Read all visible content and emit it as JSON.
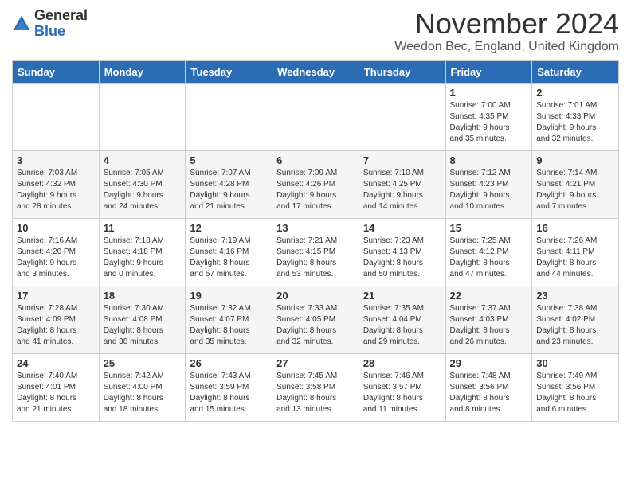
{
  "logo": {
    "general": "General",
    "blue": "Blue"
  },
  "title": "November 2024",
  "subtitle": "Weedon Bec, England, United Kingdom",
  "days_of_week": [
    "Sunday",
    "Monday",
    "Tuesday",
    "Wednesday",
    "Thursday",
    "Friday",
    "Saturday"
  ],
  "weeks": [
    [
      {
        "day": "",
        "info": ""
      },
      {
        "day": "",
        "info": ""
      },
      {
        "day": "",
        "info": ""
      },
      {
        "day": "",
        "info": ""
      },
      {
        "day": "",
        "info": ""
      },
      {
        "day": "1",
        "info": "Sunrise: 7:00 AM\nSunset: 4:35 PM\nDaylight: 9 hours\nand 35 minutes."
      },
      {
        "day": "2",
        "info": "Sunrise: 7:01 AM\nSunset: 4:33 PM\nDaylight: 9 hours\nand 32 minutes."
      }
    ],
    [
      {
        "day": "3",
        "info": "Sunrise: 7:03 AM\nSunset: 4:32 PM\nDaylight: 9 hours\nand 28 minutes."
      },
      {
        "day": "4",
        "info": "Sunrise: 7:05 AM\nSunset: 4:30 PM\nDaylight: 9 hours\nand 24 minutes."
      },
      {
        "day": "5",
        "info": "Sunrise: 7:07 AM\nSunset: 4:28 PM\nDaylight: 9 hours\nand 21 minutes."
      },
      {
        "day": "6",
        "info": "Sunrise: 7:09 AM\nSunset: 4:26 PM\nDaylight: 9 hours\nand 17 minutes."
      },
      {
        "day": "7",
        "info": "Sunrise: 7:10 AM\nSunset: 4:25 PM\nDaylight: 9 hours\nand 14 minutes."
      },
      {
        "day": "8",
        "info": "Sunrise: 7:12 AM\nSunset: 4:23 PM\nDaylight: 9 hours\nand 10 minutes."
      },
      {
        "day": "9",
        "info": "Sunrise: 7:14 AM\nSunset: 4:21 PM\nDaylight: 9 hours\nand 7 minutes."
      }
    ],
    [
      {
        "day": "10",
        "info": "Sunrise: 7:16 AM\nSunset: 4:20 PM\nDaylight: 9 hours\nand 3 minutes."
      },
      {
        "day": "11",
        "info": "Sunrise: 7:18 AM\nSunset: 4:18 PM\nDaylight: 9 hours\nand 0 minutes."
      },
      {
        "day": "12",
        "info": "Sunrise: 7:19 AM\nSunset: 4:16 PM\nDaylight: 8 hours\nand 57 minutes."
      },
      {
        "day": "13",
        "info": "Sunrise: 7:21 AM\nSunset: 4:15 PM\nDaylight: 8 hours\nand 53 minutes."
      },
      {
        "day": "14",
        "info": "Sunrise: 7:23 AM\nSunset: 4:13 PM\nDaylight: 8 hours\nand 50 minutes."
      },
      {
        "day": "15",
        "info": "Sunrise: 7:25 AM\nSunset: 4:12 PM\nDaylight: 8 hours\nand 47 minutes."
      },
      {
        "day": "16",
        "info": "Sunrise: 7:26 AM\nSunset: 4:11 PM\nDaylight: 8 hours\nand 44 minutes."
      }
    ],
    [
      {
        "day": "17",
        "info": "Sunrise: 7:28 AM\nSunset: 4:09 PM\nDaylight: 8 hours\nand 41 minutes."
      },
      {
        "day": "18",
        "info": "Sunrise: 7:30 AM\nSunset: 4:08 PM\nDaylight: 8 hours\nand 38 minutes."
      },
      {
        "day": "19",
        "info": "Sunrise: 7:32 AM\nSunset: 4:07 PM\nDaylight: 8 hours\nand 35 minutes."
      },
      {
        "day": "20",
        "info": "Sunrise: 7:33 AM\nSunset: 4:05 PM\nDaylight: 8 hours\nand 32 minutes."
      },
      {
        "day": "21",
        "info": "Sunrise: 7:35 AM\nSunset: 4:04 PM\nDaylight: 8 hours\nand 29 minutes."
      },
      {
        "day": "22",
        "info": "Sunrise: 7:37 AM\nSunset: 4:03 PM\nDaylight: 8 hours\nand 26 minutes."
      },
      {
        "day": "23",
        "info": "Sunrise: 7:38 AM\nSunset: 4:02 PM\nDaylight: 8 hours\nand 23 minutes."
      }
    ],
    [
      {
        "day": "24",
        "info": "Sunrise: 7:40 AM\nSunset: 4:01 PM\nDaylight: 8 hours\nand 21 minutes."
      },
      {
        "day": "25",
        "info": "Sunrise: 7:42 AM\nSunset: 4:00 PM\nDaylight: 8 hours\nand 18 minutes."
      },
      {
        "day": "26",
        "info": "Sunrise: 7:43 AM\nSunset: 3:59 PM\nDaylight: 8 hours\nand 15 minutes."
      },
      {
        "day": "27",
        "info": "Sunrise: 7:45 AM\nSunset: 3:58 PM\nDaylight: 8 hours\nand 13 minutes."
      },
      {
        "day": "28",
        "info": "Sunrise: 7:46 AM\nSunset: 3:57 PM\nDaylight: 8 hours\nand 11 minutes."
      },
      {
        "day": "29",
        "info": "Sunrise: 7:48 AM\nSunset: 3:56 PM\nDaylight: 8 hours\nand 8 minutes."
      },
      {
        "day": "30",
        "info": "Sunrise: 7:49 AM\nSunset: 3:56 PM\nDaylight: 8 hours\nand 6 minutes."
      }
    ]
  ]
}
